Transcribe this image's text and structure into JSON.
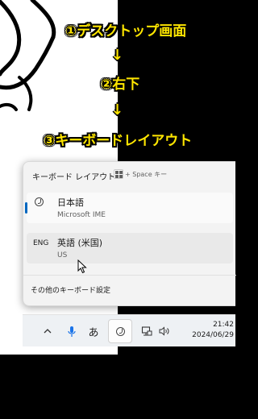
{
  "captions": {
    "step1": "①デスクトップ画面",
    "arrow1": "↓",
    "step2": "②右下",
    "arrow2": "↓",
    "step3": "③キーボードレイアウト"
  },
  "flyout": {
    "title": "キーボード レイアウト",
    "shortcut_hint": "+ Space キー",
    "options": [
      {
        "code": "",
        "name": "日本語",
        "sub": "Microsoft IME",
        "selected": true
      },
      {
        "code": "ENG",
        "name": "英語 (米国)",
        "sub": "US",
        "selected": false
      }
    ],
    "settings_link": "その他のキーボード設定"
  },
  "taskbar": {
    "ime_mode": "あ",
    "time": "21:42",
    "date": "2024/06/29"
  },
  "colors": {
    "caption": "#ffe600",
    "accent": "#0067c0",
    "flyout_bg": "#f3f3f3",
    "taskbar_bg": "#eef1f4"
  },
  "icons": [
    "chevron-up-icon",
    "microphone-icon",
    "ime-icon",
    "network-icon",
    "volume-icon",
    "windows-key-icon",
    "mouse-cursor-icon"
  ]
}
